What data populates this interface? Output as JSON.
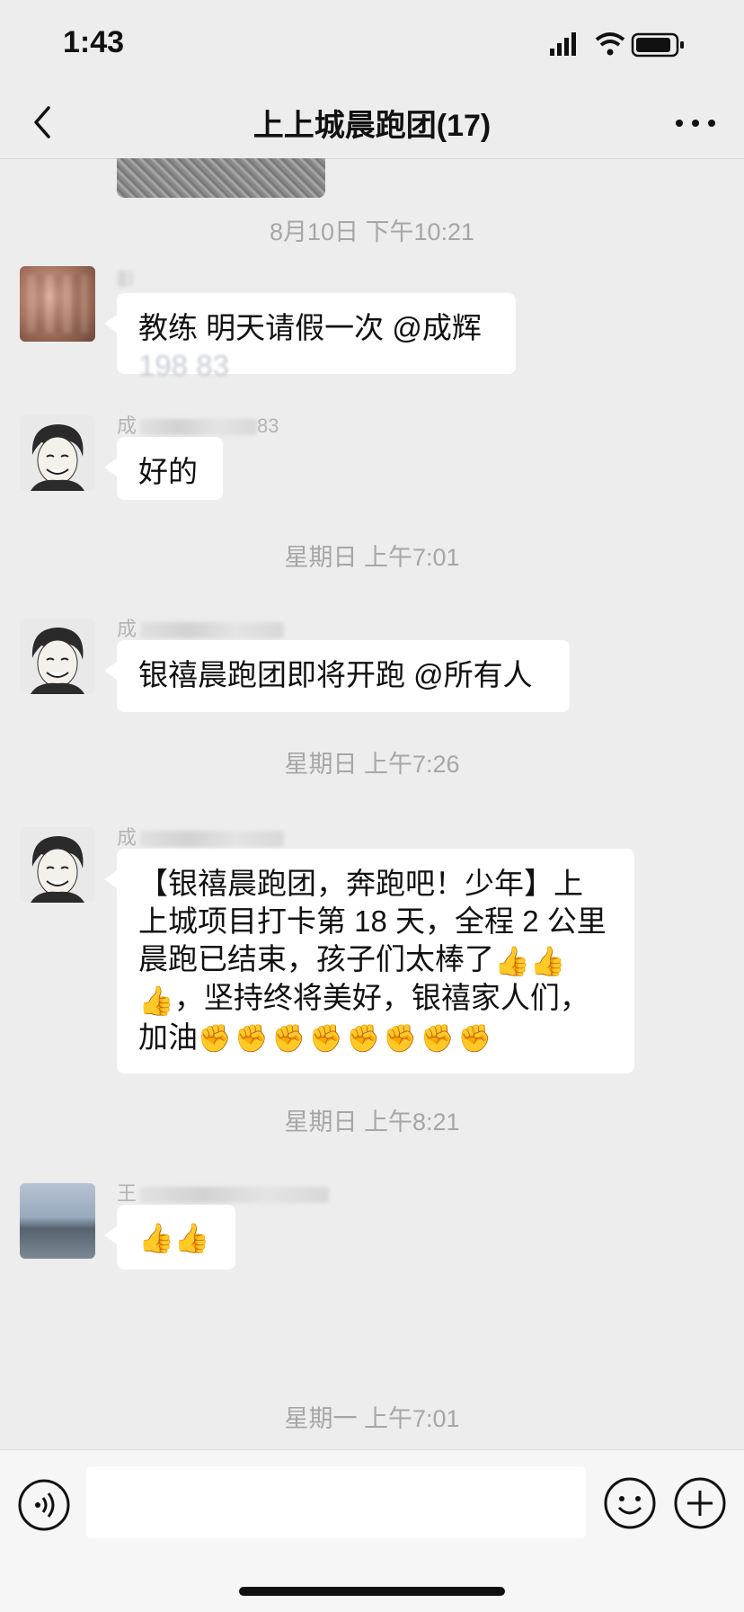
{
  "status": {
    "time": "1:43"
  },
  "nav": {
    "title": "上上城晨跑团(17)"
  },
  "timestamps": [
    "8月10日 下午10:21",
    "星期日 上午7:01",
    "星期日 上午7:26",
    "星期日 上午8:21",
    "星期一 上午7:01"
  ],
  "messages": [
    {
      "sender": "",
      "line1": "教练 明天请假一次 @成辉",
      "line2": "198    83"
    },
    {
      "sender": "成",
      "sender_tail": "83",
      "text": "好的"
    },
    {
      "sender": "成",
      "text": "银禧晨跑团即将开跑 @所有人"
    },
    {
      "sender": "成",
      "lines": [
        "【银禧晨跑团，奔跑吧！少年】上",
        "上城项目打卡第 18 天，全程 2 公里",
        "晨跑已结束，孩子们太棒了",
        "，坚持终将美好，银禧家人们，",
        "加油"
      ]
    },
    {
      "sender": "王",
      "text": "👍👍"
    }
  ],
  "emoji": {
    "thumbs": "👍",
    "fist": "✊"
  },
  "input": {
    "placeholder": ""
  },
  "icons": [
    "back-arrow-icon",
    "more-icon",
    "signal-icon",
    "wifi-icon",
    "battery-icon",
    "voice-icon",
    "emoji-icon",
    "plus-icon"
  ]
}
